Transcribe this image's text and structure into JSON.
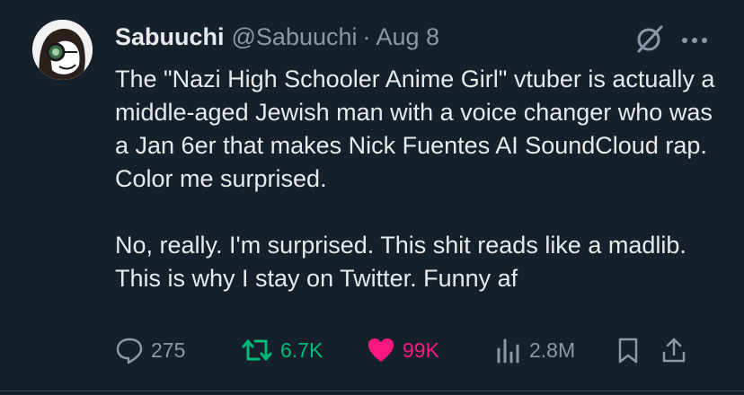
{
  "tweet": {
    "display_name": "Sabuuchi",
    "handle": "@Sabuuchi",
    "separator": "·",
    "date": "Aug 8",
    "text_paragraph_1": "The \"Nazi High Schooler Anime Girl\" vtuber is actually a middle-aged Jewish man with a voice changer who was a Jan 6er that makes Nick Fuentes AI SoundCloud rap. Color me surprised.",
    "text_paragraph_2": "No, really. I'm surprised. This shit reads like a madlib. This is why I stay on Twitter. Funny af"
  },
  "stats": {
    "replies": "275",
    "retweets": "6.7K",
    "likes": "99K",
    "views": "2.8M"
  },
  "icons": {
    "grok": "grok-icon",
    "more": "more-icon",
    "reply": "reply-icon",
    "retweet": "retweet-icon",
    "like": "heart-icon",
    "views": "views-icon",
    "bookmark": "bookmark-icon",
    "share": "share-icon"
  },
  "colors": {
    "background": "#15202b",
    "text": "#e7e9ea",
    "muted": "#8b98a5",
    "retweet_active": "#00ba7c",
    "like_active": "#f91880"
  }
}
